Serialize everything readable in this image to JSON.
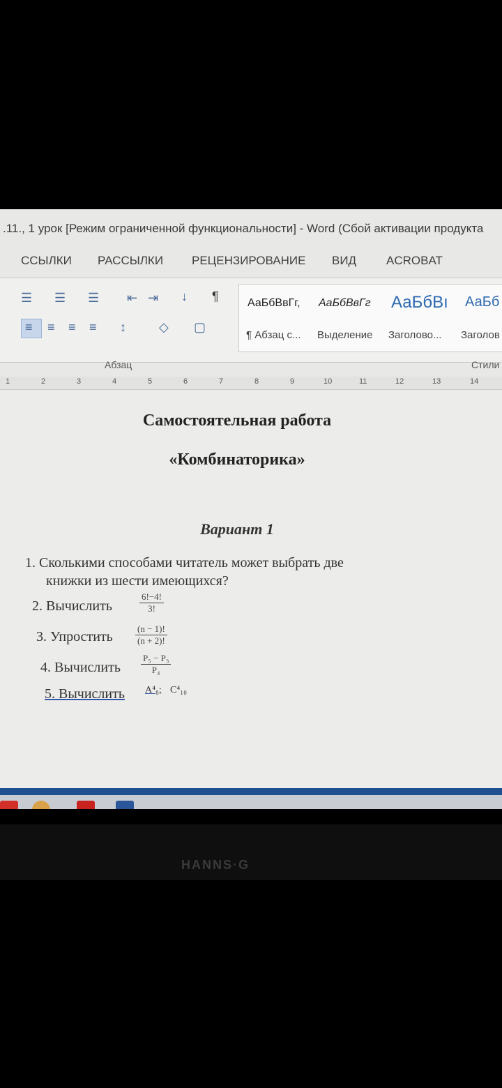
{
  "window": {
    "title": ".11., 1 урок [Режим ограниченной функциональности] - Word (Сбой активации продукта"
  },
  "ribbon": {
    "tabs": [
      "ССЫЛКИ",
      "РАССЫЛКИ",
      "РЕЦЕНЗИРОВАНИЕ",
      "ВИД",
      "ACROBAT"
    ],
    "paragraph_group_label": "Абзац",
    "styles_group_label": "Стили",
    "styles": [
      {
        "sample": "АаБбВвГг,",
        "name": "¶ Абзац с..."
      },
      {
        "sample": "АаБбВвГг",
        "name": "Выделение"
      },
      {
        "sample": "АаБбВı",
        "name": "Заголово..."
      },
      {
        "sample": "АаБб",
        "name": "Заголов"
      }
    ]
  },
  "ruler": {
    "ticks": [
      "1",
      "2",
      "3",
      "4",
      "5",
      "6",
      "7",
      "8",
      "9",
      "10",
      "11",
      "12",
      "13",
      "14"
    ]
  },
  "document": {
    "title": "Самостоятельная работа",
    "subtitle": "«Комбинаторика»",
    "variant": "Вариант 1",
    "task1": {
      "line1": "1. Сколькими способами читатель может выбрать две",
      "line2": "книжки из шести имеющихся?"
    },
    "task2": {
      "text": "2. Вычислить",
      "numerator": "6!−4!",
      "denominator": "3!"
    },
    "task3": {
      "text": "3. Упростить",
      "numerator": "(n − 1)!",
      "denominator": "(n + 2)!"
    },
    "task4": {
      "text": "4. Вычислить",
      "numerator": "P₅ − P₃",
      "denominator": "P₄"
    },
    "task5": {
      "text": "5. Вычислить",
      "expr1": "A⁴₈;",
      "expr2": "C⁴₁₀"
    }
  },
  "monitor": {
    "brand": "HANNS·G"
  },
  "colors": {
    "taskbar_accent": "#1e4f8f",
    "ribbon_icon": "#4a6a9a"
  }
}
